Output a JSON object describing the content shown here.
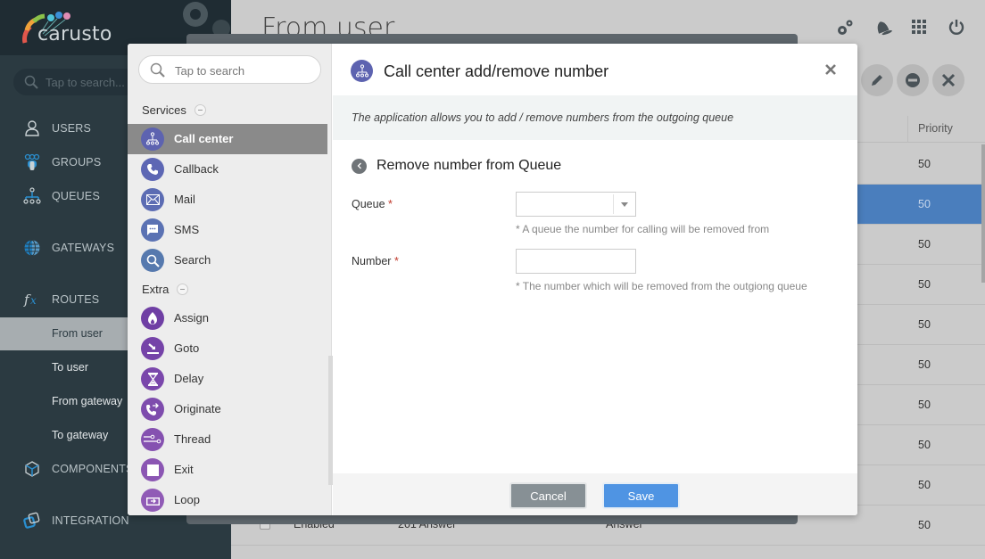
{
  "app": {
    "brand": "carusto"
  },
  "sidebar": {
    "search_placeholder": "Tap to search...",
    "items": [
      {
        "label": "USERS",
        "icon": "user-icon"
      },
      {
        "label": "GROUPS",
        "icon": "group-icon"
      },
      {
        "label": "QUEUES",
        "icon": "queue-icon"
      },
      {
        "label": "GATEWAYS",
        "icon": "globe-icon"
      },
      {
        "label": "ROUTES",
        "icon": "fx-icon"
      },
      {
        "label": "COMPONENTS",
        "icon": "cube-icon"
      },
      {
        "label": "INTEGRATION",
        "icon": "integration-icon"
      }
    ],
    "route_subitems": [
      {
        "label": "From user",
        "active": true
      },
      {
        "label": "To user",
        "active": false
      },
      {
        "label": "From gateway",
        "active": false
      },
      {
        "label": "To gateway",
        "active": false
      }
    ]
  },
  "main": {
    "title": "From user",
    "top_icons": [
      "settings-icon",
      "bell-icon",
      "apps-grid-icon",
      "power-icon"
    ],
    "action_buttons": [
      "edit-icon",
      "disable-icon",
      "delete-icon"
    ],
    "table": {
      "columns": {
        "priority": "Priority"
      },
      "rows": [
        {
          "priority": "50",
          "selected": false
        },
        {
          "priority": "50",
          "selected": true
        },
        {
          "priority": "50",
          "selected": false
        },
        {
          "priority": "50",
          "selected": false
        },
        {
          "priority": "50",
          "selected": false
        },
        {
          "priority": "50",
          "selected": false
        },
        {
          "priority": "50",
          "selected": false
        },
        {
          "priority": "50",
          "selected": false
        },
        {
          "priority": "50",
          "selected": false
        },
        {
          "priority": "50",
          "selected": false,
          "status": "Enabled",
          "code": "201 Answer",
          "action": "Answer"
        }
      ]
    }
  },
  "modal": {
    "search_placeholder": "Tap to search",
    "groups": [
      {
        "label": "Services",
        "items": [
          {
            "label": "Call center",
            "icon": "call-center-icon",
            "color": "#5d63b0",
            "active": true
          },
          {
            "label": "Callback",
            "icon": "phone-icon",
            "color": "#5d67b4",
            "active": false
          },
          {
            "label": "Mail",
            "icon": "mail-icon",
            "color": "#5c6cb3",
            "active": false
          },
          {
            "label": "SMS",
            "icon": "sms-icon",
            "color": "#5b72b3",
            "active": false
          },
          {
            "label": "Search",
            "icon": "search-icon",
            "color": "#5679ae",
            "active": false
          }
        ]
      },
      {
        "label": "Extra",
        "items": [
          {
            "label": "Assign",
            "icon": "flame-icon",
            "color": "#6f3fa4",
            "active": false
          },
          {
            "label": "Goto",
            "icon": "goto-icon",
            "color": "#7543a8",
            "active": false
          },
          {
            "label": "Delay",
            "icon": "hourglass-icon",
            "color": "#7a47ab",
            "active": false
          },
          {
            "label": "Originate",
            "icon": "originate-icon",
            "color": "#7e4cad",
            "active": false
          },
          {
            "label": "Thread",
            "icon": "thread-icon",
            "color": "#8551b0",
            "active": false
          },
          {
            "label": "Exit",
            "icon": "stop-icon",
            "color": "#8b56b3",
            "active": false
          },
          {
            "label": "Loop",
            "icon": "loop-icon",
            "color": "#905bb6",
            "active": false
          }
        ]
      }
    ],
    "title": "Call center add/remove number",
    "description": "The application allows you to add / remove numbers from the outgoing queue",
    "subtitle": "Remove number from Queue",
    "fields": {
      "queue": {
        "label": "Queue",
        "required_mark": "*",
        "value": "",
        "hint": "* A queue the number for calling will be removed from"
      },
      "number": {
        "label": "Number",
        "required_mark": "*",
        "value": "",
        "hint": "* The number which will be removed from the outgiong queue"
      }
    },
    "buttons": {
      "cancel": "Cancel",
      "save": "Save"
    }
  }
}
